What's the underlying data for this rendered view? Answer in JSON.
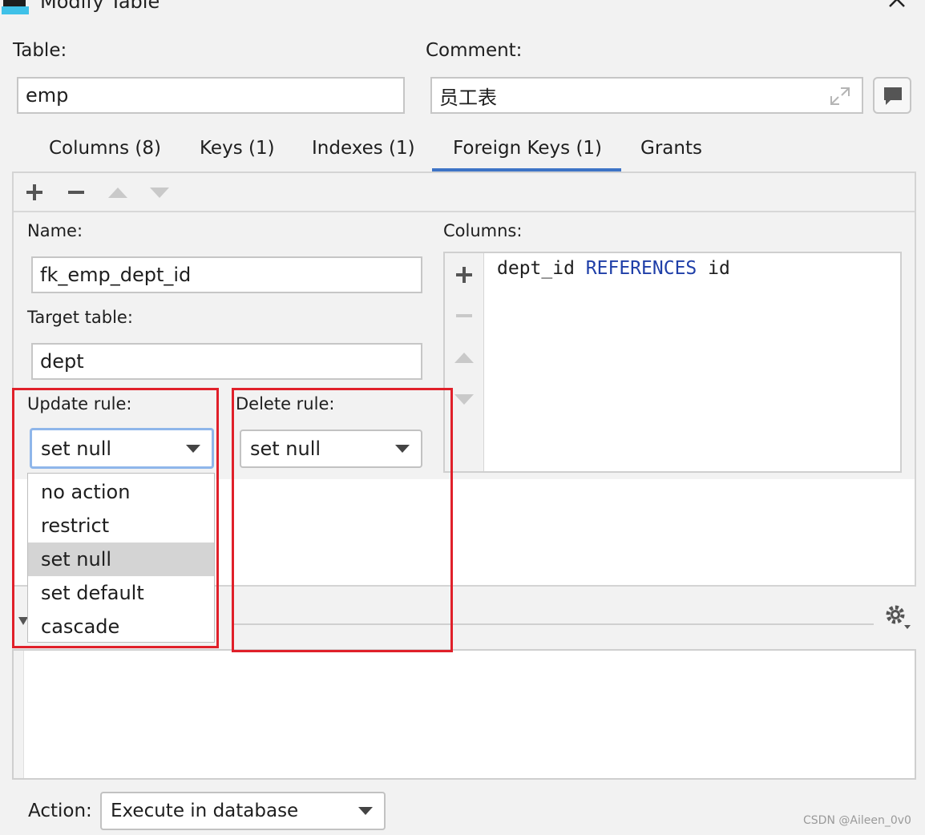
{
  "window": {
    "title": "Modify Table",
    "close_label": "×"
  },
  "table": {
    "label": "Table:",
    "value": "emp"
  },
  "comment": {
    "label": "Comment:",
    "value": "员工表"
  },
  "tabs": [
    {
      "label": "Columns (8)",
      "active": false
    },
    {
      "label": "Keys (1)",
      "active": false
    },
    {
      "label": "Indexes (1)",
      "active": false
    },
    {
      "label": "Foreign Keys (1)",
      "active": true
    },
    {
      "label": "Grants",
      "active": false
    }
  ],
  "toolbar": {
    "add_icon": "plus-icon",
    "remove_icon": "minus-icon",
    "move_up_icon": "triangle-up-icon",
    "move_down_icon": "triangle-down-icon"
  },
  "foreign_key": {
    "name_label": "Name:",
    "name_value": "fk_emp_dept_id",
    "target_label": "Target table:",
    "target_value": "dept",
    "update_rule_label": "Update rule:",
    "update_rule_value": "set null",
    "delete_rule_label": "Delete rule:",
    "delete_rule_value": "set null",
    "columns_label": "Columns:",
    "columns_line": {
      "source": "dept_id",
      "keyword": "REFERENCES",
      "target": "id"
    }
  },
  "update_rule_options": [
    "no action",
    "restrict",
    "set null",
    "set default",
    "cascade"
  ],
  "update_rule_selected_index": 2,
  "action": {
    "label": "Action:",
    "value": "Execute in database"
  },
  "watermark": "CSDN @Aileen_0v0",
  "colors": {
    "accent": "#3e74c6",
    "highlight_box": "#e0202a",
    "keyword": "#1f3fa8"
  }
}
